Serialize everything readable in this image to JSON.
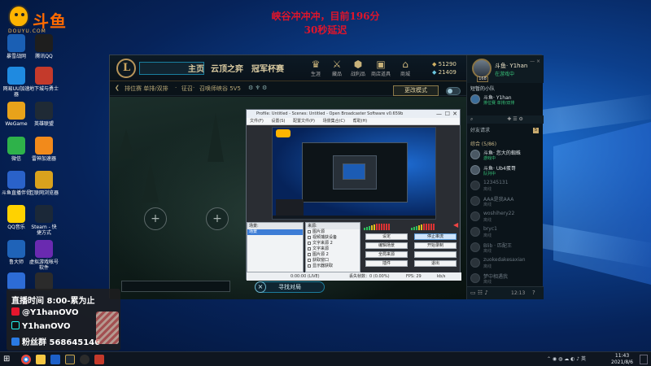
{
  "logo": {
    "brand": "斗鱼",
    "url": "DOUYU.COM"
  },
  "overlay": {
    "line1": "峡谷冲冲冲，目前196分",
    "line2": "30秒延迟"
  },
  "desktop_icons": [
    {
      "label": "暴雪战网",
      "icon": "battlenet-icon",
      "color": "#1a5fb4"
    },
    {
      "label": "腾讯QQ",
      "icon": "qq-icon",
      "color": "#1e1e1e"
    },
    {
      "label": "网易UU加速器",
      "icon": "uu-icon",
      "color": "#1f8ae0"
    },
    {
      "label": "地下城与勇士",
      "icon": "dnf-icon",
      "color": "#c43a2b"
    },
    {
      "label": "WeGame",
      "icon": "wegame-icon",
      "color": "#e8a21a"
    },
    {
      "label": "英雄联盟",
      "icon": "lol-icon",
      "color": "#1f2a35"
    },
    {
      "label": "微信",
      "icon": "wechat-icon",
      "color": "#2eb24a"
    },
    {
      "label": "雷神加速器",
      "icon": "leishen-icon",
      "color": "#f28a1b"
    },
    {
      "label": "斗鱼直播伴侣",
      "icon": "douyu-companion-icon",
      "color": "#2a62c9"
    },
    {
      "label": "互联网浏览器",
      "icon": "chrome-icon",
      "color": "#d9a21d"
    },
    {
      "label": "QQ音乐",
      "icon": "qqmusic-icon",
      "color": "#ffd200"
    },
    {
      "label": "Steam - 快捷方式",
      "icon": "steam-icon",
      "color": "#1b2838"
    },
    {
      "label": "鲁大师",
      "icon": "ludashi-icon",
      "color": "#1f63b8"
    },
    {
      "label": "虚拟游戏帐号 软件",
      "icon": "account-icon",
      "color": "#6a2ab0"
    },
    {
      "label": "",
      "icon": "monitor-icon",
      "color": "#2d6cd6"
    },
    {
      "label": "",
      "icon": "obs-icon",
      "color": "#2b2b2b"
    }
  ],
  "lol": {
    "play_label": "",
    "tabs": [
      "主页",
      "云顶之弈",
      "冠军杯赛"
    ],
    "top_icons": [
      {
        "icon": "collection-icon",
        "label": "生涯"
      },
      {
        "icon": "loot-icon",
        "label": "藏品"
      },
      {
        "icon": "tft-icon",
        "label": "战利品"
      },
      {
        "icon": "clash-icon",
        "label": "商店道具"
      },
      {
        "icon": "store-icon",
        "label": "商城"
      }
    ],
    "currency": {
      "be": "51290",
      "rp": "21409"
    },
    "sub": {
      "mode": "排位赛 单排/双排",
      "sep": "·",
      "role": "征召",
      "sep2": "·",
      "extra": "召唤师峡谷 5V5"
    },
    "edit_mode": "更改模式",
    "find_match": "寻找对局",
    "find_cancel": "×",
    "slot_glyph": "+"
  },
  "social": {
    "name": "斗鱼· Y1han",
    "status": "在游戏中",
    "level": "168",
    "group": "短暂的小队",
    "group_sub": "排位赛 单排/双排",
    "section_title": "好友请求",
    "section_count": "5",
    "friend_group": "综合 (5/86)",
    "friends": [
      {
        "name": "斗鱼· 您大的蜘蛛",
        "status": "游戏中",
        "off": false
      },
      {
        "name": "斗鱼· Ub4蛋哥",
        "status": "队列中",
        "off": false
      },
      {
        "name": "12345131",
        "status": "离线",
        "off": true
      },
      {
        "name": "AAA是我AAA",
        "status": "离线",
        "off": true
      },
      {
        "name": "woshihery22",
        "status": "离线",
        "off": true
      },
      {
        "name": "bryc1",
        "status": "离线",
        "off": true
      },
      {
        "name": "Blib · 匹配王",
        "status": "离线",
        "off": true
      },
      {
        "name": "zuokedakesaxian",
        "status": "离线",
        "off": true
      },
      {
        "name": "梦中相遇我",
        "status": "离线",
        "off": true
      }
    ],
    "bottom_time": "12:13"
  },
  "obs": {
    "title": "Profile: Untitled - Scenes: Untitled - Open Broadcaster Software v0.659b",
    "menu": [
      "文件(F)",
      "设置(S)",
      "配置文件(P)",
      "场景集合(C)",
      "帮助(H)"
    ],
    "scenes_label": "场景:",
    "sources_label": "来源:",
    "scene_selected": "场景",
    "sources": [
      "图片源",
      "视频捕获设备",
      "文字来源 2",
      "文字来源",
      "图片源 2",
      "获取窗口",
      "显示器获取"
    ],
    "buttons": [
      "设定",
      "停止串流",
      "编辑场景",
      "开始录制",
      "全局来源",
      "",
      "插件",
      "退出"
    ],
    "status": {
      "frames": "丢失帧数：0 (0.00%)",
      "time": "0:00:00 (LIVE)",
      "fps": "FPS: 29",
      "kbps": "kb/s"
    }
  },
  "card": {
    "schedule": "直播时间 8:00-累为止",
    "weibo": "@Y1hanOVO",
    "douyin": "Y1hanOVO",
    "fans": "粉丝群 568645146"
  },
  "taskbar": {
    "time": "11:43",
    "date": "2021/8/6"
  }
}
